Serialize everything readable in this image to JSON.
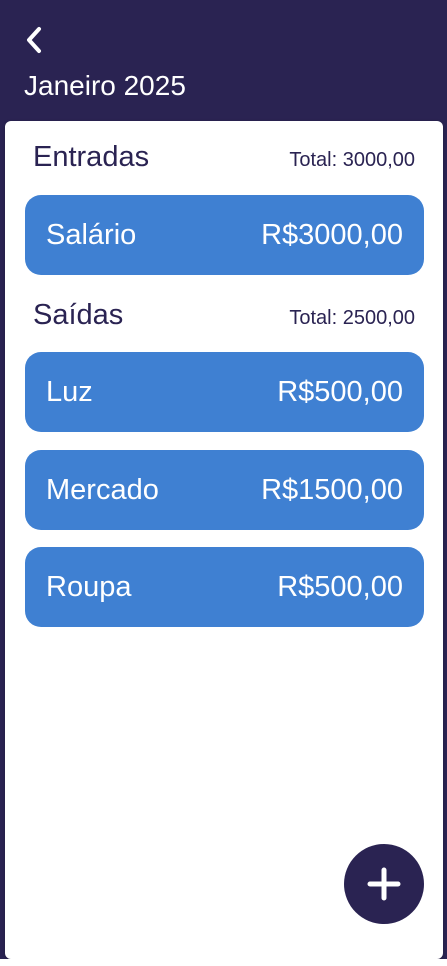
{
  "header": {
    "title": "Janeiro 2025"
  },
  "entradas": {
    "title": "Entradas",
    "total": "Total: 3000,00",
    "items": [
      {
        "label": "Salário",
        "value": "R$3000,00"
      }
    ]
  },
  "saidas": {
    "title": "Saídas",
    "total": "Total: 2500,00",
    "items": [
      {
        "label": "Luz",
        "value": "R$500,00"
      },
      {
        "label": "Mercado",
        "value": "R$1500,00"
      },
      {
        "label": "Roupa",
        "value": "R$500,00"
      }
    ]
  },
  "icons": {
    "back": "chevron-left-icon",
    "add": "plus-icon"
  },
  "colors": {
    "primary_dark": "#2a2352",
    "item_blue": "#3f80d2",
    "card_bg": "#ffffff"
  }
}
